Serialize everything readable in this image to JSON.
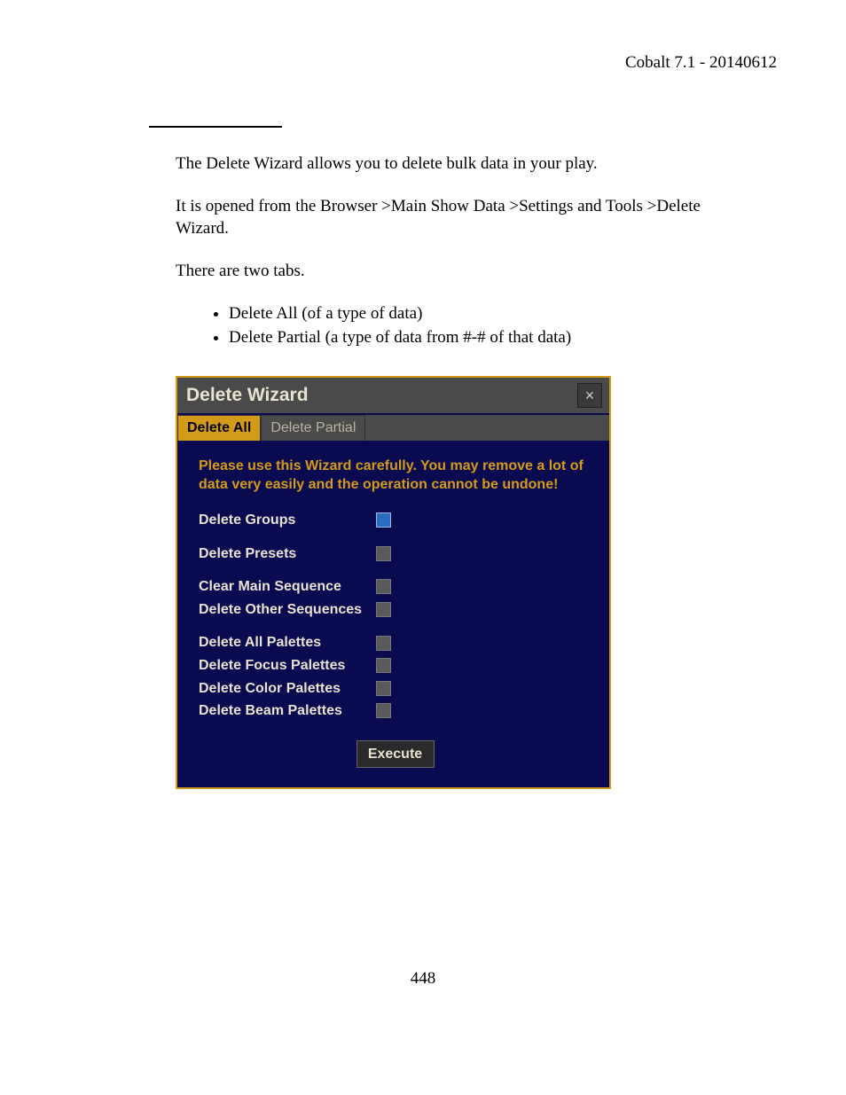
{
  "header": "Cobalt 7.1 - 20140612",
  "para1": "The Delete Wizard allows you to delete bulk data in your play.",
  "para2": "It is opened from the Browser >Main Show Data >Settings and Tools >Delete Wizard.",
  "para3": "There are two tabs.",
  "bullets": [
    "Delete All (of a type of data)",
    "Delete Partial (a type of data from #-# of that data)"
  ],
  "wizard": {
    "title": "Delete Wizard",
    "close": "×",
    "tabs": {
      "active": "Delete All",
      "inactive": "Delete Partial"
    },
    "warning": "Please use this Wizard carefully. You may remove a lot of data very easily and the operation cannot be undone!",
    "rows": [
      {
        "label": "Delete Groups",
        "checked": true,
        "gap": false
      },
      {
        "label": "Delete Presets",
        "checked": false,
        "gap": true
      },
      {
        "label": "Clear Main Sequence",
        "checked": false,
        "gap": true
      },
      {
        "label": "Delete Other Sequences",
        "checked": false,
        "gap": false
      },
      {
        "label": "Delete All Palettes",
        "checked": false,
        "gap": true
      },
      {
        "label": "Delete Focus Palettes",
        "checked": false,
        "gap": false
      },
      {
        "label": "Delete Color Palettes",
        "checked": false,
        "gap": false
      },
      {
        "label": "Delete Beam Palettes",
        "checked": false,
        "gap": false
      }
    ],
    "execute": "Execute"
  },
  "page_number": "448"
}
